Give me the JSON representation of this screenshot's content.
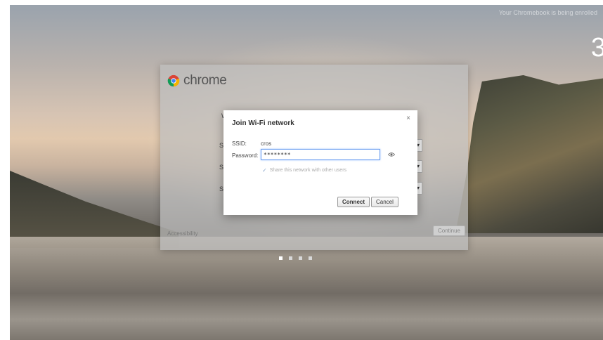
{
  "status_banner": "Your Chromebook is being enrolled",
  "clock": "3",
  "oobe": {
    "brand": "chrome",
    "row_labels": [
      "W",
      "S",
      "S",
      "S"
    ],
    "dropdown_glyph": "▾",
    "accessibility_link": "Accessibility",
    "continue_label": "Continue",
    "page_dots": [
      1,
      2,
      3,
      4
    ]
  },
  "wifi_dialog": {
    "title": "Join Wi-Fi network",
    "close_glyph": "×",
    "ssid_label": "SSID:",
    "ssid_value": "cros",
    "password_label": "Password:",
    "password_value": "********",
    "share_checkbox_glyph": "✓",
    "share_label": "Share this network with other users",
    "share_checked": true,
    "connect_label": "Connect",
    "cancel_label": "Cancel"
  },
  "icons": {
    "brand_logo": "chrome-logo-icon",
    "show_password": "eye-icon",
    "close": "close-icon"
  },
  "colors": {
    "focus_ring": "#6b9ef0",
    "dialog_bg": "#ffffff",
    "card_bg": "#bebebe"
  }
}
